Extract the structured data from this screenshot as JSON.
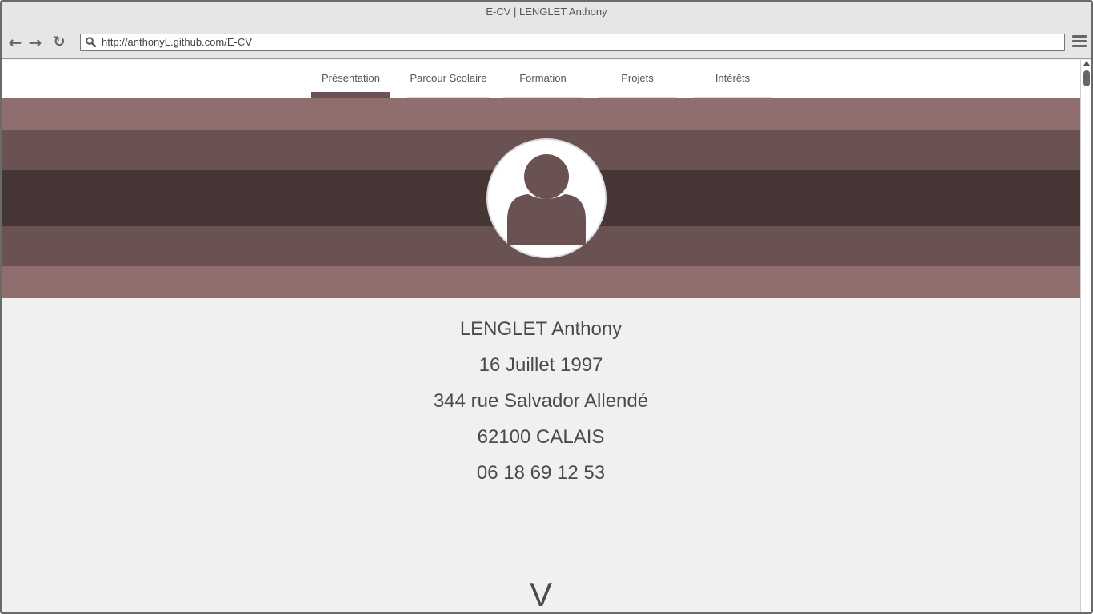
{
  "window": {
    "title": "E-CV | LENGLET Anthony"
  },
  "browser": {
    "url": "http://anthonyL.github.com/E-CV",
    "back_icon": "arrow-left-icon",
    "forward_icon": "arrow-right-icon",
    "reload_icon": "reload-icon",
    "menu_icon": "hamburger-menu-icon"
  },
  "nav": {
    "tabs": [
      {
        "label": "Présentation",
        "active": true
      },
      {
        "label": "Parcour Scolaire",
        "active": false
      },
      {
        "label": "Formation",
        "active": false
      },
      {
        "label": "Projets",
        "active": false
      },
      {
        "label": "Intérêts",
        "active": false
      }
    ]
  },
  "colors": {
    "band_light": "#916e6e",
    "band_mid": "#6b5252",
    "band_dark": "#463535",
    "avatar_fill": "#6b5252"
  },
  "profile": {
    "name": "LENGLET Anthony",
    "birthdate": "16 Juillet 1997",
    "street": "344 rue Salvador Allendé",
    "city": "62100 CALAIS",
    "phone": "06 18 69 12 53"
  },
  "scroll_hint": "V"
}
